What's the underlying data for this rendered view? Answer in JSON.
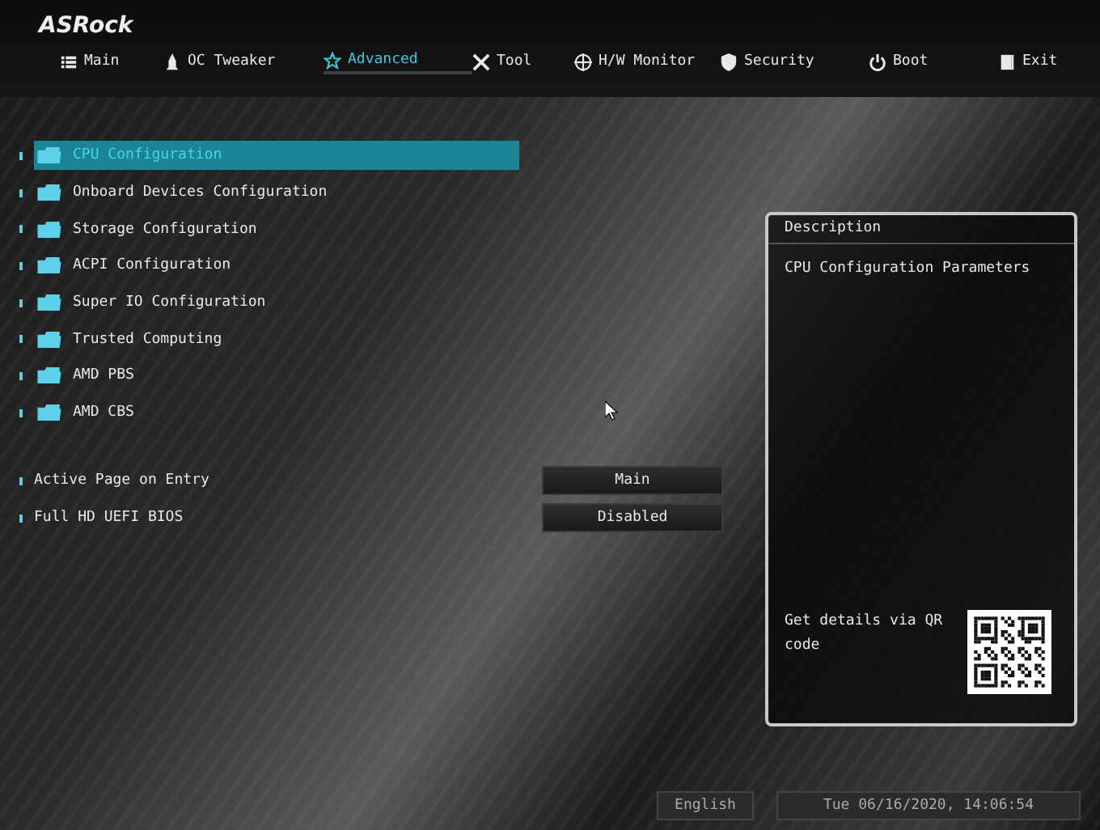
{
  "logo": "ASRock",
  "tabs": [
    {
      "label": "Main",
      "selected": false
    },
    {
      "label": "OC Tweaker",
      "selected": false
    },
    {
      "label": "Advanced",
      "selected": true
    },
    {
      "label": "Tool",
      "selected": false
    },
    {
      "label": "H/W Monitor",
      "selected": false
    },
    {
      "label": "Security",
      "selected": false
    },
    {
      "label": "Boot",
      "selected": false
    },
    {
      "label": "Exit",
      "selected": false
    }
  ],
  "menu_items": [
    {
      "label": "CPU Configuration",
      "selected": true
    },
    {
      "label": "Onboard Devices Configuration",
      "selected": false
    },
    {
      "label": "Storage Configuration",
      "selected": false
    },
    {
      "label": "ACPI Configuration",
      "selected": false
    },
    {
      "label": "Super IO Configuration",
      "selected": false
    },
    {
      "label": "Trusted Computing",
      "selected": false
    },
    {
      "label": "AMD PBS",
      "selected": false
    },
    {
      "label": "AMD CBS",
      "selected": false
    }
  ],
  "settings": [
    {
      "label": "Active Page on Entry",
      "value": "Main"
    },
    {
      "label": "Full HD UEFI BIOS",
      "value": "Disabled"
    }
  ],
  "description": {
    "title": "Description",
    "text": "CPU Configuration Parameters",
    "qr_text": "Get details via QR code"
  },
  "status_bar": {
    "language": "English",
    "datetime": "Tue 06/16/2020, 14:06:54"
  }
}
